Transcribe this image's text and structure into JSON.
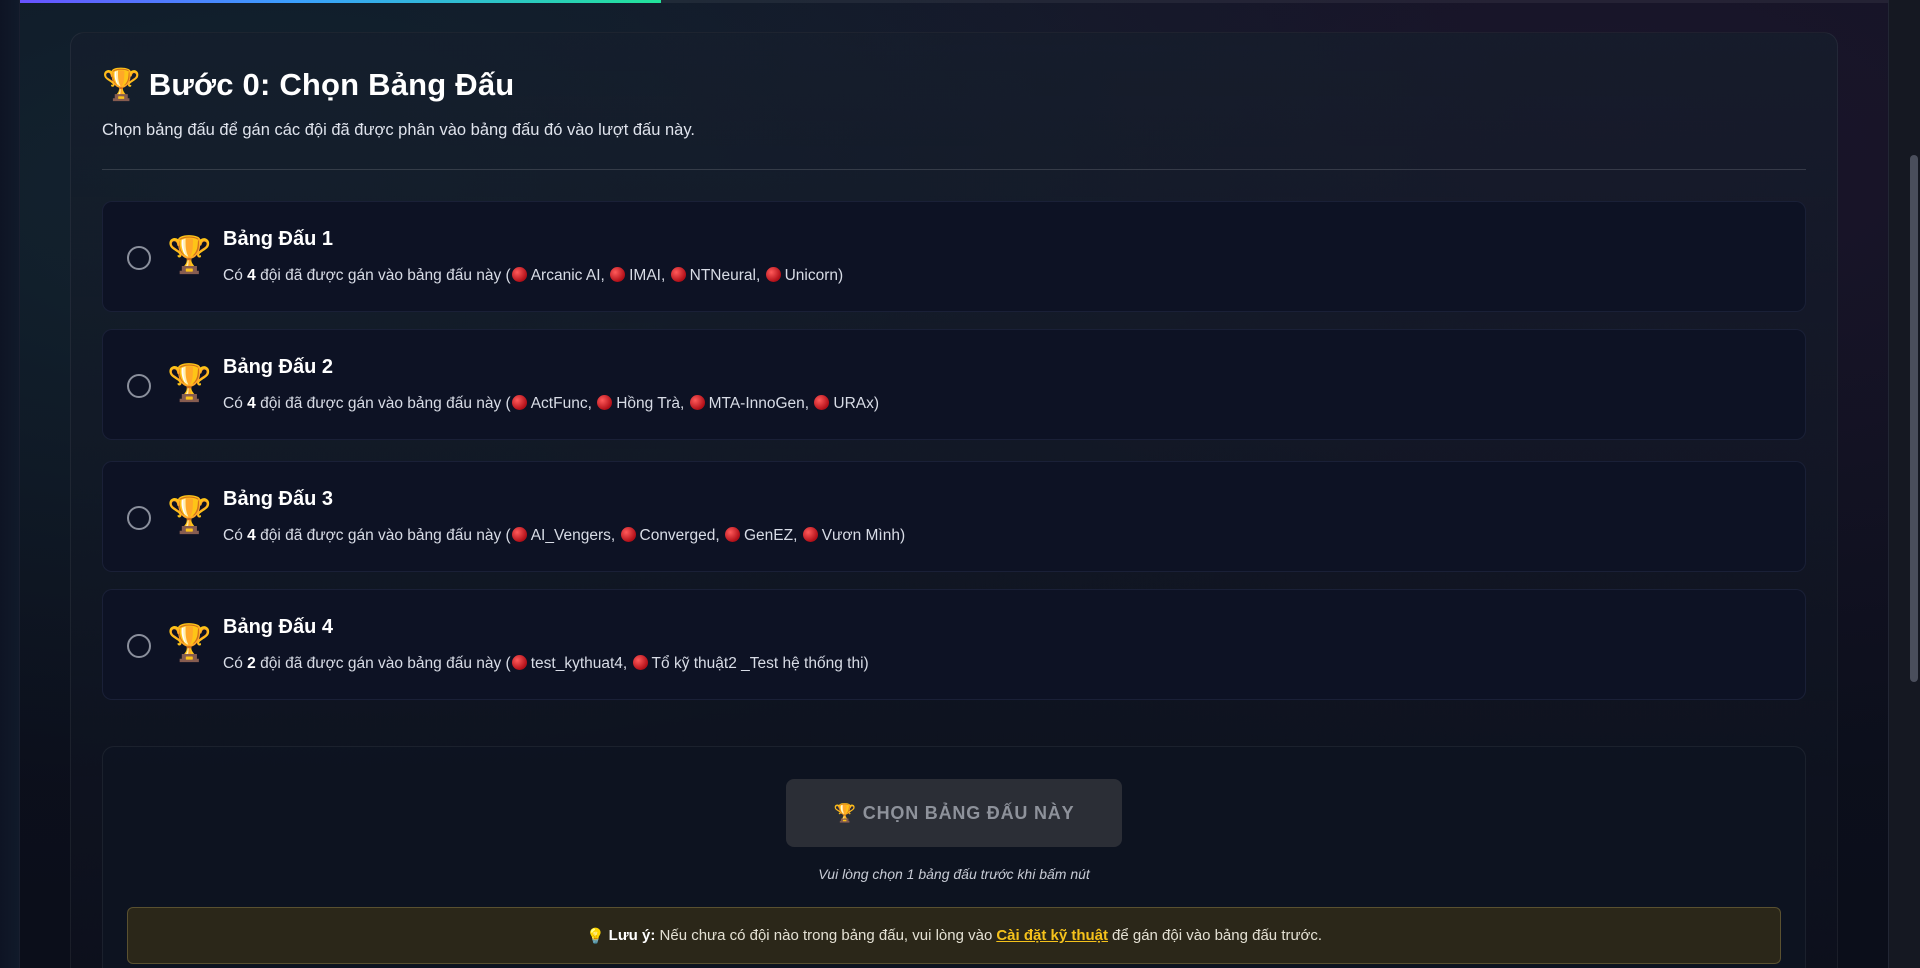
{
  "colors": {
    "background": "#0b0e1a",
    "card": "#0d1224",
    "accent_link": "#f5c21b",
    "note_bg": "#2b2719",
    "button_disabled": "#2b2e36",
    "team_dot": "#d0202a"
  },
  "progress": {
    "value_fraction": 0.35
  },
  "header": {
    "icon": "trophy-icon",
    "icon_glyph": "🏆",
    "title": "Bước 0: Chọn Bảng Đấu",
    "description": "Chọn bảng đấu để gán các đội đã được phân vào bảng đấu đó vào lượt đấu này."
  },
  "groups": [
    {
      "title": "Bảng Đấu 1",
      "desc_prefix": "Có",
      "count": "4",
      "desc_middle": "đội đã được gán vào bảng đấu này (",
      "teams": [
        "Arcanic AI",
        "IMAI",
        "NTNeural",
        "Unicorn"
      ],
      "desc_suffix": ")"
    },
    {
      "title": "Bảng Đấu 2",
      "desc_prefix": "Có",
      "count": "4",
      "desc_middle": "đội đã được gán vào bảng đấu này (",
      "teams": [
        "ActFunc",
        "Hồng Trà",
        "MTA-InnoGen",
        "URAx"
      ],
      "desc_suffix": ")"
    },
    {
      "title": "Bảng Đấu 3",
      "desc_prefix": "Có",
      "count": "4",
      "desc_middle": "đội đã được gán vào bảng đấu này (",
      "teams": [
        "AI_Vengers",
        "Converged",
        "GenEZ",
        "Vươn Mình"
      ],
      "desc_suffix": ")"
    },
    {
      "title": "Bảng Đấu 4",
      "desc_prefix": "Có",
      "count": "2",
      "desc_middle": "đội đã được gán vào bảng đấu này (",
      "teams": [
        "test_kythuat4",
        "Tổ kỹ thuật2 _Test hệ thống thi"
      ],
      "desc_suffix": ")"
    }
  ],
  "actions": {
    "choose_icon": "🏆",
    "choose_label": "CHỌN BẢNG ĐẤU NÀY",
    "hint": "Vui lòng chọn 1 bảng đấu trước khi bấm nút"
  },
  "note": {
    "icon": "lightbulb-icon",
    "icon_glyph": "💡",
    "label": "Lưu ý:",
    "text_before": "Nếu chưa có đội nào trong bảng đấu, vui lòng vào",
    "link_text": "Cài đặt kỹ thuật",
    "text_after": "để gán đội vào bảng đấu trước."
  }
}
